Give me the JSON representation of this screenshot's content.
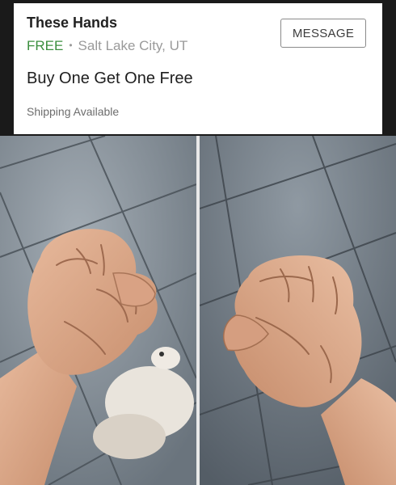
{
  "listing": {
    "title": "These Hands",
    "price": "FREE",
    "separator": "•",
    "location": "Salt Lake City, UT",
    "headline": "Buy One Get One Free",
    "shipping": "Shipping Available",
    "message_button": "MESSAGE"
  },
  "photos": [
    {
      "subject": "left fist over tiled floor with white dog"
    },
    {
      "subject": "right fist over tiled floor"
    }
  ],
  "colors": {
    "price_green": "#3c8f3f",
    "card_bg": "#ffffff",
    "tile_light": "#8d97a0",
    "tile_dark": "#6f7a84",
    "skin": "#d8a88a"
  }
}
